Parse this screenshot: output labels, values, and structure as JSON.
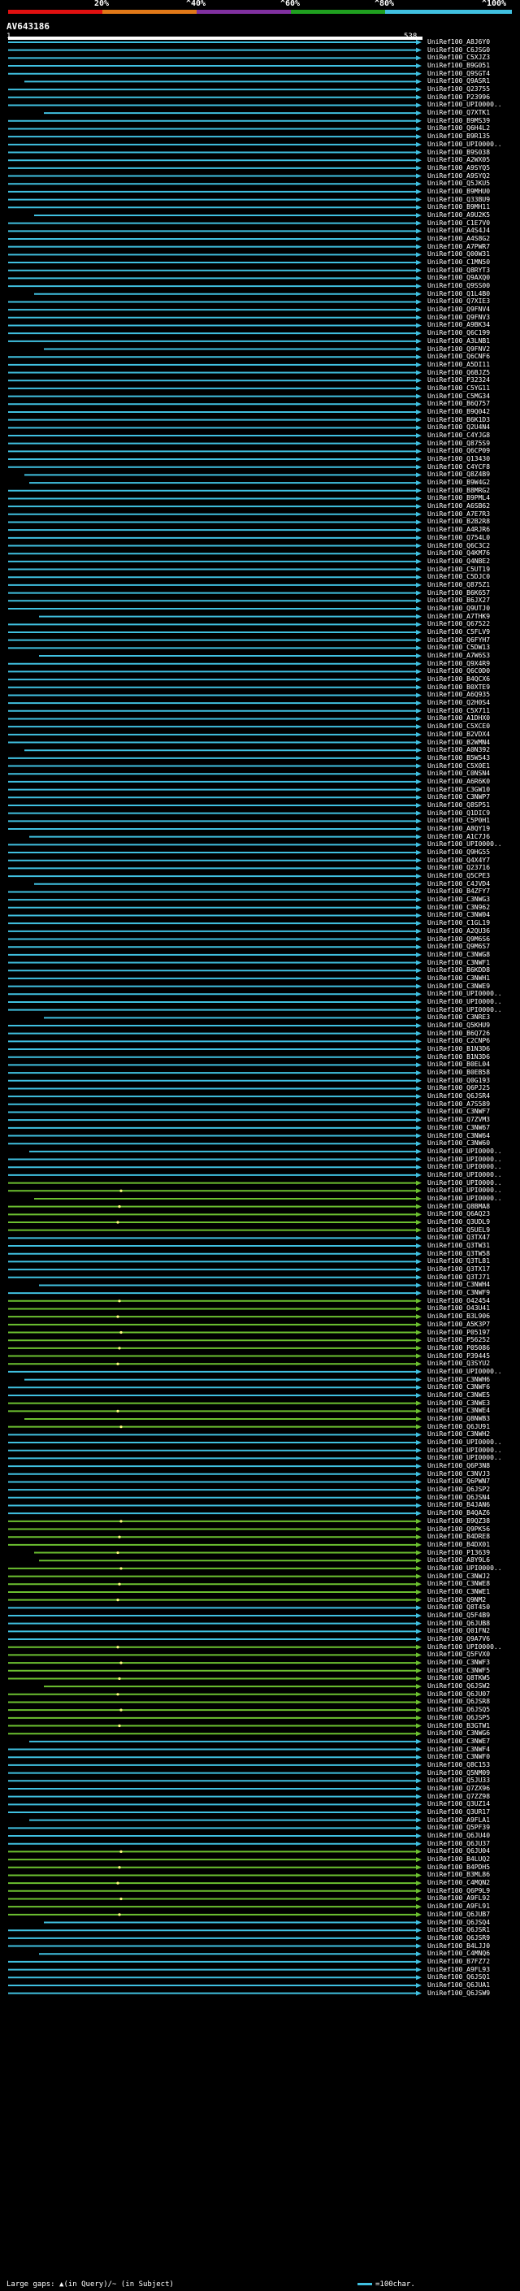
{
  "scale": {
    "ticks": [
      "20%",
      "^40%",
      "^60%",
      "^80%",
      "^100%"
    ],
    "colors": [
      "#e01010",
      "#e07818",
      "#8030a0",
      "#20a020",
      "#40c0e0"
    ]
  },
  "query": {
    "id": "AV643186",
    "start": "1",
    "end": "538"
  },
  "colors": {
    "cyan": "#40c0e0",
    "green": "#6cc030",
    "gap": "#ffff80",
    "background": "#000000"
  },
  "chart_data": {
    "type": "alignment-map",
    "x_range": [
      1,
      538
    ],
    "hits": [
      "UniRef100_A8J6Y0",
      "UniRef100_C6JSG0",
      "UniRef100_C5XJZ3",
      "UniRef100_B9G051",
      "UniRef100_Q9SGT4",
      "UniRef100_Q9ASR1",
      "UniRef100_Q23755",
      "UniRef100_P23996",
      "UniRef100_UPI0000..",
      "UniRef100_Q7XTK1",
      "UniRef100_B9MS39",
      "UniRef100_Q6H4L2",
      "UniRef100_B9R135",
      "UniRef100_UPI0000..",
      "UniRef100_B9S038",
      "UniRef100_A2WX05",
      "UniRef100_A9SYQ5",
      "UniRef100_A9SYQ2",
      "UniRef100_Q5JKU5",
      "UniRef100_B9MHU0",
      "UniRef100_Q33BU9",
      "UniRef100_B9MH11",
      "UniRef100_A9U2K5",
      "UniRef100_C1E7V0",
      "UniRef100_A4S4J4",
      "UniRef100_A4S8G2",
      "UniRef100_A7PWR7",
      "UniRef100_Q00W31",
      "UniRef100_C1MN50",
      "UniRef100_Q8RYT3",
      "UniRef100_Q9AXQ0",
      "UniRef100_Q9SS00",
      "UniRef100_Q1L4B0",
      "UniRef100_Q7XIE3",
      "UniRef100_Q9FNV4",
      "UniRef100_Q9FNV3",
      "UniRef100_A9BK34",
      "UniRef100_Q6C199",
      "UniRef100_A3LNB1",
      "UniRef100_Q9FNV2",
      "UniRef100_Q6CNF6",
      "UniRef100_A5DI11",
      "UniRef100_Q6BJZ5",
      "UniRef100_P32324",
      "UniRef100_C5YG11",
      "UniRef100_C5MG34",
      "UniRef100_B6Q757",
      "UniRef100_B9Q042",
      "UniRef100_B6K1D3",
      "UniRef100_Q2U4N4",
      "UniRef100_C4YJG8",
      "UniRef100_Q875S9",
      "UniRef100_Q6CP09",
      "UniRef100_Q13430",
      "UniRef100_C4YCF8",
      "UniRef100_Q8Z4B9",
      "UniRef100_B9W4G2",
      "UniRef100_B8MRG2",
      "UniRef100_B9PML4",
      "UniRef100_A6SB62",
      "UniRef100_A7E7R3",
      "UniRef100_B2B2R8",
      "UniRef100_A4RJR6",
      "UniRef100_Q754L0",
      "UniRef100_Q6C3C2",
      "UniRef100_Q4KM76",
      "UniRef100_Q4NBE2",
      "UniRef100_C5UT19",
      "UniRef100_C5DJC0",
      "UniRef100_Q875Z1",
      "UniRef100_B6K657",
      "UniRef100_B6JX27",
      "UniRef100_Q9UTJ0",
      "UniRef100_A7THK9",
      "UniRef100_Q67522",
      "UniRef100_C5FLV9",
      "UniRef100_Q6FYH7",
      "UniRef100_C5DW13",
      "UniRef100_A7W6S3",
      "UniRef100_Q9X4R9",
      "UniRef100_Q6C0D0",
      "UniRef100_B4QCX6",
      "UniRef100_B0XTE9",
      "UniRef100_A6Q935",
      "UniRef100_Q2H0S4",
      "UniRef100_C5X711",
      "UniRef100_A1DHX0",
      "UniRef100_C5XCE0",
      "UniRef100_B2VDX4",
      "UniRef100_B2WMN4",
      "UniRef100_A0N392",
      "UniRef100_B5W543",
      "UniRef100_C5X0E1",
      "UniRef100_C0NSN4",
      "UniRef100_A6R6K0",
      "UniRef100_C3GW10",
      "UniRef100_C3NWP7",
      "UniRef100_Q8SP51",
      "UniRef100_Q1DIC9",
      "UniRef100_C5P0H1",
      "UniRef100_A8QY19",
      "UniRef100_A1C7J6",
      "UniRef100_UPI0000..",
      "UniRef100_Q9HG55",
      "UniRef100_Q4X4Y7",
      "UniRef100_Q23716",
      "UniRef100_Q5CPE3",
      "UniRef100_C4JVD4",
      "UniRef100_B4ZFY7",
      "UniRef100_C3NWG3",
      "UniRef100_C3N962",
      "UniRef100_C3NW04",
      "UniRef100_C1GL19",
      "UniRef100_A2QU36",
      "UniRef100_Q9M6S6",
      "UniRef100_Q9M6S7",
      "UniRef100_C3NWG8",
      "UniRef100_C3NWF1",
      "UniRef100_B6KDD8",
      "UniRef100_C3NWH1",
      "UniRef100_C3NWE9",
      "UniRef100_UPI0000..",
      "UniRef100_UPI0000..",
      "UniRef100_UPI0000..",
      "UniRef100_C3NRE3",
      "UniRef100_Q5KHU9",
      "UniRef100_B6Q726",
      "UniRef100_C2CNP6",
      "UniRef100_B1N3D6",
      "UniRef100_B1N3D6",
      "UniRef100_B0EL04",
      "UniRef100_B0EB58",
      "UniRef100_Q0G193",
      "UniRef100_Q6PJ25",
      "UniRef100_Q6JSR4",
      "UniRef100_A7S589",
      "UniRef100_C3NWF7",
      "UniRef100_Q7ZVM3",
      "UniRef100_C3NW67",
      "UniRef100_C3NW64",
      "UniRef100_C3NW60",
      "UniRef100_UPI0000..",
      "UniRef100_UPI0000..",
      "UniRef100_UPI0000..",
      "UniRef100_UPI0000..",
      "UniRef100_UPI0000..",
      "UniRef100_UPI0000..",
      "UniRef100_UPI0000..",
      "UniRef100_Q8BMA8",
      "UniRef100_Q6AQ23",
      "UniRef100_Q3UDL9",
      "UniRef100_Q5UEL9",
      "UniRef100_Q3TX47",
      "UniRef100_Q3TW31",
      "UniRef100_Q3TW58",
      "UniRef100_Q3TL81",
      "UniRef100_Q3TX17",
      "UniRef100_Q3TJ71",
      "UniRef100_C3NWH4",
      "UniRef100_C3NWF9",
      "UniRef100_O42454",
      "UniRef100_O43U41",
      "UniRef100_B3L906",
      "UniRef100_A5K3P7",
      "UniRef100_P05197",
      "UniRef100_P56252",
      "UniRef100_P05086",
      "UniRef100_P39445",
      "UniRef100_Q3SYU2",
      "UniRef100_UPI0000..",
      "UniRef100_C3NWH6",
      "UniRef100_C3NWF6",
      "UniRef100_C3NWE5",
      "UniRef100_C3NWE3",
      "UniRef100_C3NWE4",
      "UniRef100_Q8NWB3",
      "UniRef100_Q6JU91",
      "UniRef100_C3NWH2",
      "UniRef100_UPI0000..",
      "UniRef100_UPI0000..",
      "UniRef100_UPI0000..",
      "UniRef100_Q6P3N8",
      "UniRef100_C3NVJ3",
      "UniRef100_Q6PWN7",
      "UniRef100_Q6JSP2",
      "UniRef100_Q6JSN4",
      "UniRef100_B4JAN6",
      "UniRef100_B4QAZ6",
      "UniRef100_B9QZ38",
      "UniRef100_Q9PK56",
      "UniRef100_B4DRE8",
      "UniRef100_B4DX01",
      "UniRef100_P13639",
      "UniRef100_A8Y9L6",
      "UniRef100_UPI0000..",
      "UniRef100_C3NWJ2",
      "UniRef100_C3NWE8",
      "UniRef100_C3NWE1",
      "UniRef100_Q9NM2",
      "UniRef100_Q8T450",
      "UniRef100_Q5F4B9",
      "UniRef100_Q6JUB8",
      "UniRef100_Q01FN2",
      "UniRef100_Q9A7V6",
      "UniRef100_UPI0000..",
      "UniRef100_Q5FVX0",
      "UniRef100_C3NWF3",
      "UniRef100_C3NWF5",
      "UniRef100_Q8TKW5",
      "UniRef100_Q6JSW2",
      "UniRef100_Q6JU07",
      "UniRef100_Q6JSR8",
      "UniRef100_Q6JSQ5",
      "UniRef100_Q6JSP5",
      "UniRef100_B3GTW1",
      "UniRef100_C3NWG6",
      "UniRef100_C3NWE7",
      "UniRef100_C3NWF4",
      "UniRef100_C3NWF0",
      "UniRef100_Q8C153",
      "UniRef100_Q5NM09",
      "UniRef100_Q5JU33",
      "UniRef100_Q7ZX96",
      "UniRef100_Q7ZZ98",
      "UniRef100_Q3UZ14",
      "UniRef100_Q3UR17",
      "UniRef100_A9FLA1",
      "UniRef100_Q5PF39",
      "UniRef100_Q6JU40",
      "UniRef100_Q6JU37",
      "UniRef100_Q6JU04",
      "UniRef100_B4LUQ2",
      "UniRef100_B4PDH5",
      "UniRef100_B3ML86",
      "UniRef100_C4MQN2",
      "UniRef100_Q6P9L9",
      "UniRef100_A9FL92",
      "UniRef100_A9FL91",
      "UniRef100_Q6JUB7",
      "UniRef100_Q6JSQ4",
      "UniRef100_Q6JSR1",
      "UniRef100_Q6JSR9",
      "UniRef100_B4LJJ0",
      "UniRef100_C4MNQ6",
      "UniRef100_B7FZ72",
      "UniRef100_A9FL93",
      "UniRef100_Q6JSQ1",
      "UniRef100_Q6JUA1",
      "UniRef100_Q6JSW9"
    ]
  },
  "footer": {
    "gaps_label": "Large gaps: ",
    "gaps_legend": "▲(in Query)/~ (in Subject)",
    "scale_label": "=100char."
  }
}
